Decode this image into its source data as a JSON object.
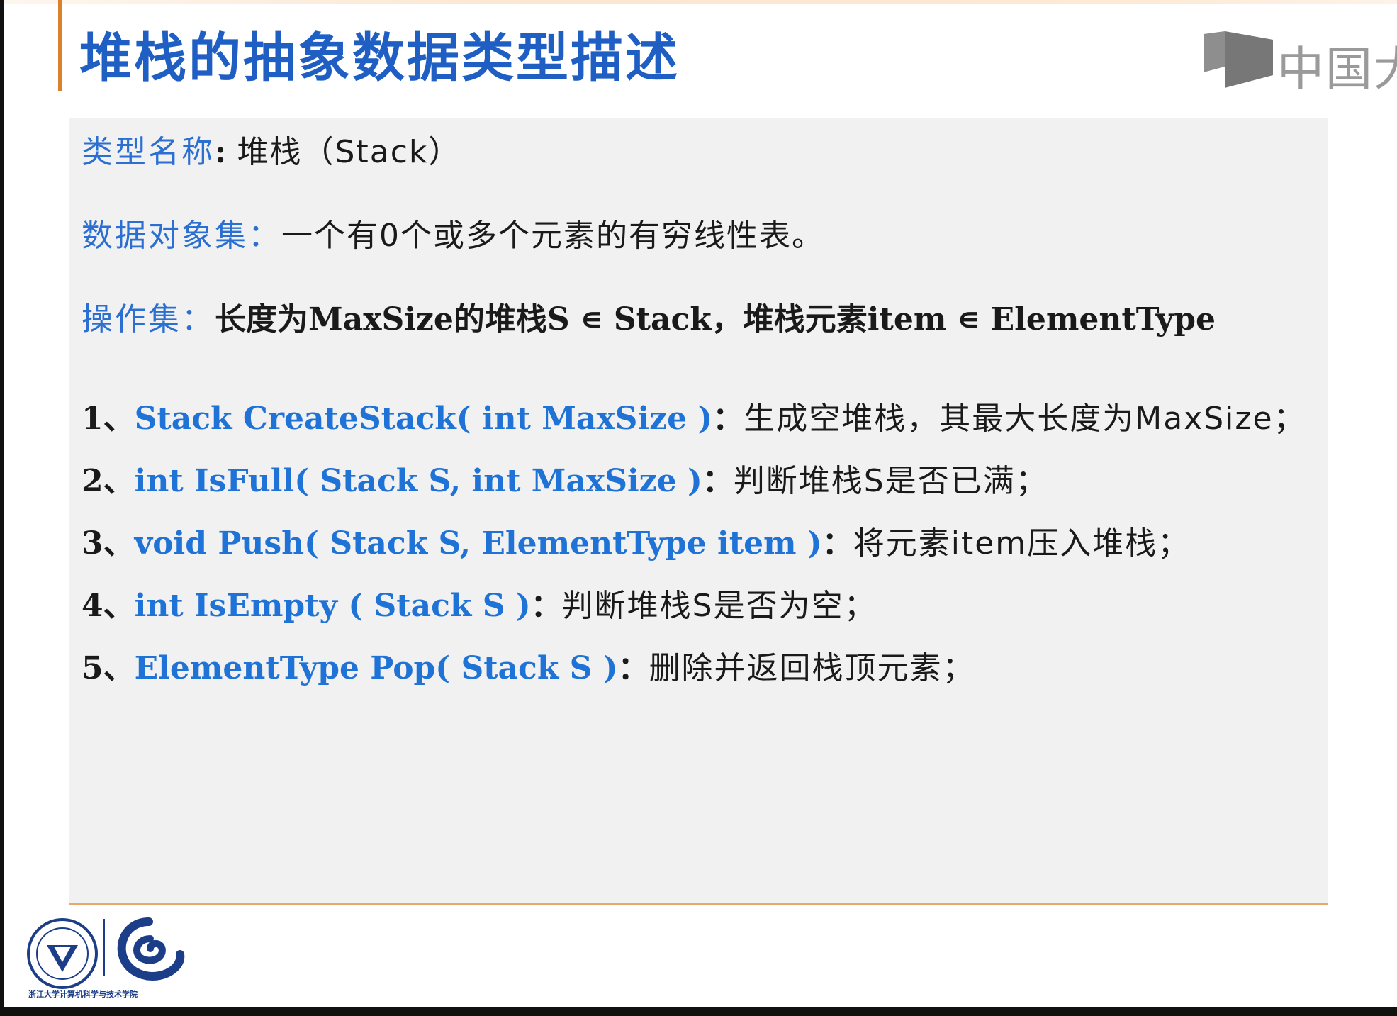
{
  "slide": {
    "title": "堆栈的抽象数据类型描述",
    "watermark": "中国大",
    "type_name": {
      "label": "类型名称",
      "sep": ": ",
      "value": "堆栈（Stack）"
    },
    "data_set": {
      "label": "数据对象集：",
      "value": "一个有0个或多个元素的有穷线性表。"
    },
    "op_set": {
      "label": "操作集：",
      "value_a": "长度为MaxSize的堆栈S ∊ Stack，",
      "value_b": "堆栈元素item ∊ ElementType"
    },
    "operations": [
      {
        "num": "1、",
        "signature": "Stack CreateStack( int MaxSize )",
        "colon": "：",
        "desc": "生成空堆栈，其最大长度为MaxSize；"
      },
      {
        "num": "2、",
        "signature": "int IsFull( Stack S, int MaxSize )",
        "colon": "：",
        "desc": "判断堆栈S是否已满；"
      },
      {
        "num": "3、",
        "signature": "void Push( Stack S, ElementType item )",
        "colon": "：",
        "desc": "将元素item压入堆栈；"
      },
      {
        "num": "4、",
        "signature": "int IsEmpty ( Stack S )",
        "colon": "：",
        "desc": "判断堆栈S是否为空；"
      },
      {
        "num": "5、",
        "signature": "ElementType Pop( Stack S )",
        "colon": "：",
        "desc": "删除并返回栈顶元素；"
      }
    ],
    "footer_org": "浙江大学计算机科学与技术学院"
  },
  "colors": {
    "title": "#1f5fc4",
    "label": "#2a6fd1",
    "code": "#1f72d6",
    "accent": "#d9822b",
    "panel": "#f1f1f1"
  }
}
